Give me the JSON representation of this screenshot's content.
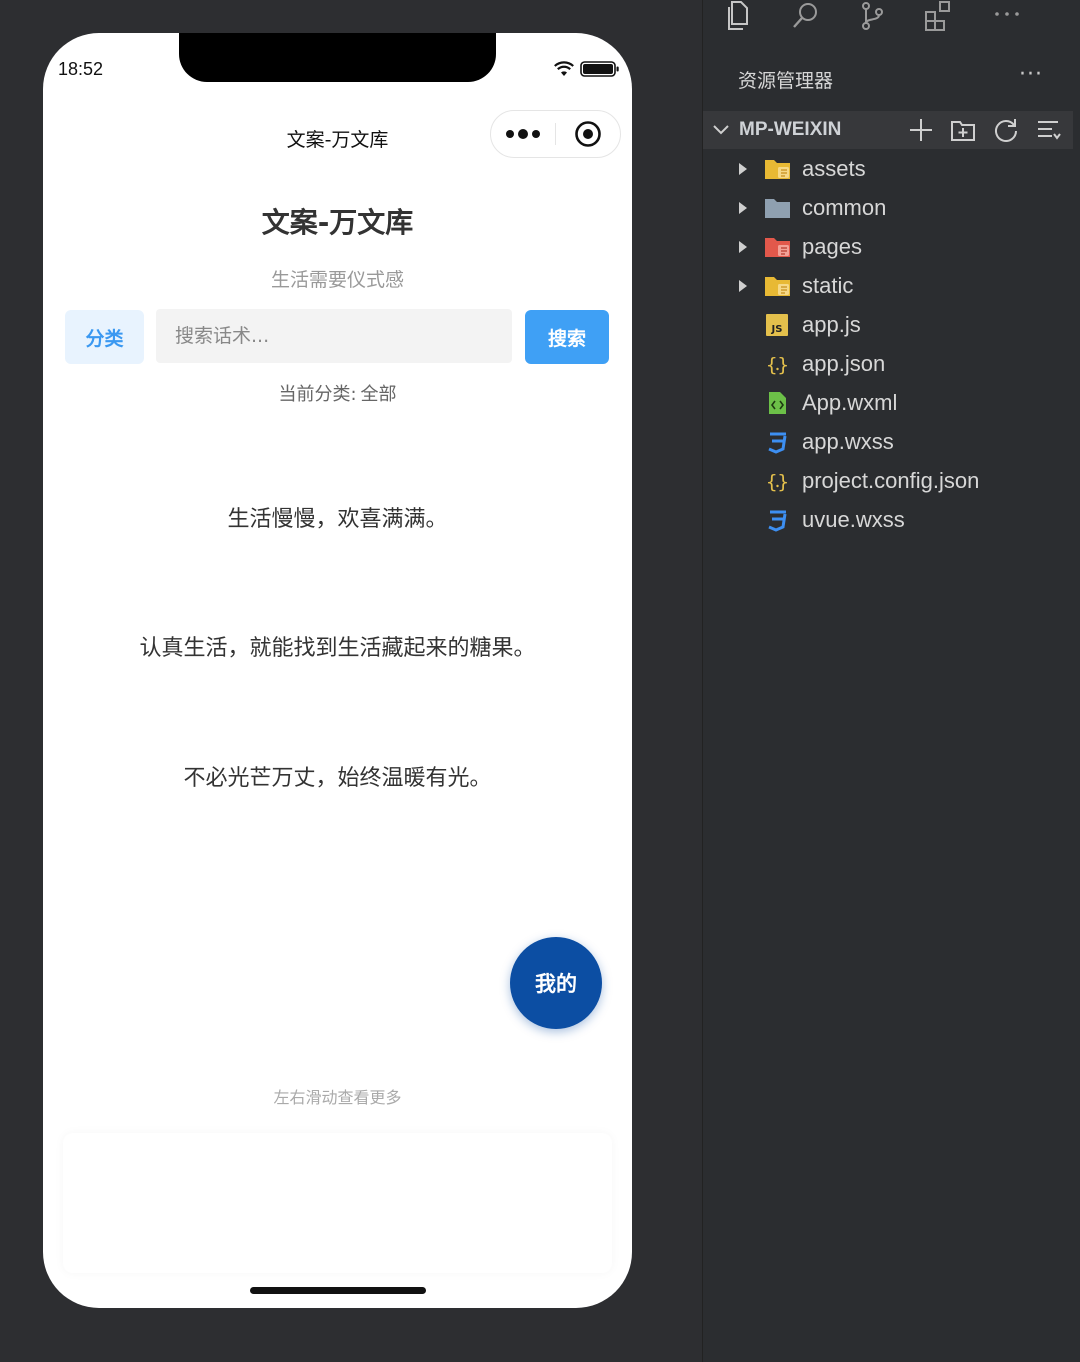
{
  "phone": {
    "status_time": "18:52",
    "nav_title": "文案-万文库",
    "app_title": "文案-万文库",
    "app_subtitle": "生活需要仪式感",
    "category_button": "分类",
    "search_placeholder": "搜索话术...",
    "search_button": "搜索",
    "current_category_label": "当前分类:",
    "current_category_value": "全部",
    "quotes": [
      "生活慢慢，欢喜满满。",
      "认真生活，就能找到生活藏起来的糖果。",
      "不必光芒万丈，始终温暖有光。"
    ],
    "mine_button": "我的",
    "swipe_hint": "左右滑动查看更多",
    "colors": {
      "accent_blue": "#3fa0f5",
      "category_blue": "#3a98f1",
      "mine_button_bg": "#0c4ea3"
    }
  },
  "explorer": {
    "header": "资源管理器",
    "more": "···",
    "project_name": "MP-WEIXIN",
    "activity_icons": [
      "files-icon",
      "search-icon",
      "source-control-icon",
      "extensions-icon",
      "more-icon"
    ],
    "tree": [
      {
        "label": "assets",
        "icon": "folder-assets-icon",
        "folder": true
      },
      {
        "label": "common",
        "icon": "folder-icon",
        "folder": true
      },
      {
        "label": "pages",
        "icon": "folder-pages-icon",
        "folder": true
      },
      {
        "label": "static",
        "icon": "folder-assets-icon",
        "folder": true
      },
      {
        "label": "app.js",
        "icon": "js-file-icon",
        "folder": false
      },
      {
        "label": "app.json",
        "icon": "json-file-icon",
        "folder": false
      },
      {
        "label": "App.wxml",
        "icon": "wxml-file-icon",
        "folder": false
      },
      {
        "label": "app.wxss",
        "icon": "css-file-icon",
        "folder": false
      },
      {
        "label": "project.config.json",
        "icon": "json-file-icon",
        "folder": false
      },
      {
        "label": "uvue.wxss",
        "icon": "css-file-icon",
        "folder": false
      }
    ],
    "colors": {
      "folder_yellow": "#e8b934",
      "folder_grey": "#8fa0b0",
      "folder_red": "#e2584b",
      "json_yellow": "#e4c04c",
      "css_blue": "#3d8ff2",
      "wxml_green": "#6cc048"
    }
  }
}
